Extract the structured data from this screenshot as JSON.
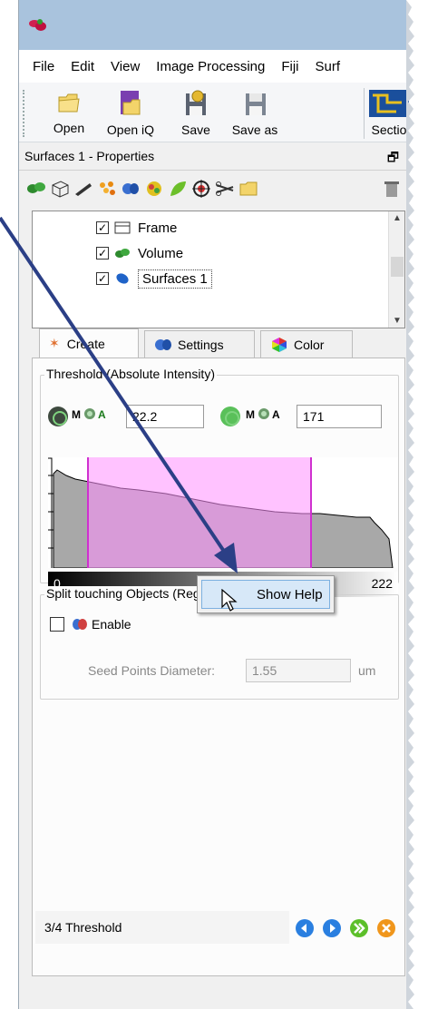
{
  "menu": [
    "File",
    "Edit",
    "View",
    "Image Processing",
    "Fiji",
    "Surf"
  ],
  "toolbar": {
    "buttons": [
      {
        "label": "Open",
        "icon": "folder-icon"
      },
      {
        "label": "Open iQ",
        "icon": "open-iq-icon"
      },
      {
        "label": "Save",
        "icon": "save-icon"
      },
      {
        "label": "Save as",
        "icon": "save-as-icon"
      },
      {
        "label": "Sectio",
        "icon": "section-icon"
      }
    ]
  },
  "properties_panel": {
    "title": "Surfaces 1 - Properties",
    "toolbar_icons": [
      "volume-icon",
      "frame-icon",
      "pen-icon",
      "spots-icon",
      "cells-icon",
      "filaments-icon",
      "leaf-icon",
      "target-icon",
      "scissors-icon",
      "folder-icon",
      "trash-icon"
    ]
  },
  "tree": {
    "items": [
      {
        "label": "Frame",
        "checked": true,
        "icon": "frame-icon"
      },
      {
        "label": "Volume",
        "checked": true,
        "icon": "volume-icon"
      },
      {
        "label": "Surfaces 1",
        "checked": true,
        "icon": "surface-icon",
        "selected": true
      }
    ]
  },
  "tabs": [
    {
      "label": "Create",
      "icon": "wand-icon",
      "active": true
    },
    {
      "label": "Settings",
      "icon": "settings-icon",
      "active": false
    },
    {
      "label": "Color",
      "icon": "color-icon",
      "active": false
    }
  ],
  "threshold": {
    "group_label": "Threshold (Absolute Intensity)",
    "mode_label": "M",
    "auto_label": "A",
    "low_value": "22.2",
    "high_value": "171",
    "range_min": "0",
    "range_max": "222",
    "accent_color": "#ff90ff"
  },
  "split": {
    "group_label": "Split touching Objects (Region Growing)",
    "enable_label": "Enable",
    "enable_checked": false,
    "seed_label": "Seed Points Diameter:",
    "seed_value": "1.55",
    "seed_unit": "um"
  },
  "context_menu": {
    "item": "Show Help"
  },
  "status": {
    "text": "3/4 Threshold"
  },
  "colors": {
    "titlebar": "#a9c3dd",
    "annotation_arrow": "#2b3f86",
    "nav_blue": "#2a7fe0",
    "nav_green": "#5cbf2a",
    "nav_orange": "#f0961c"
  }
}
